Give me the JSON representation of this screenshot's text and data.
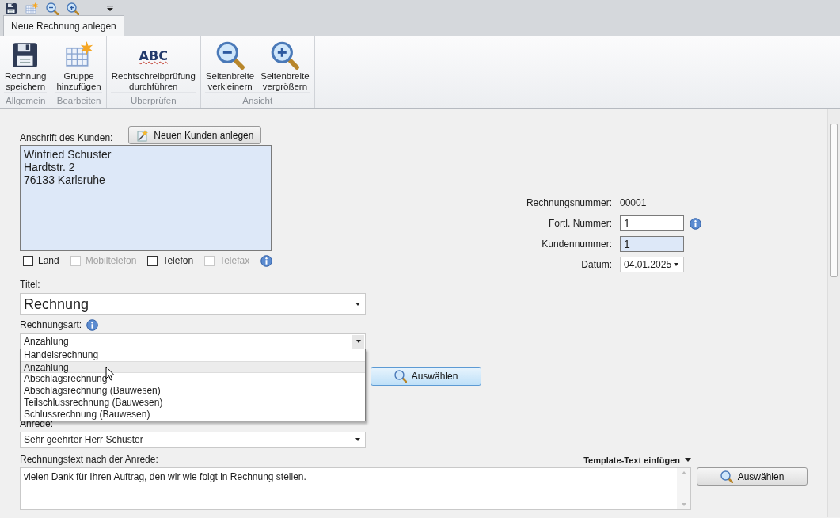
{
  "tabs": [
    {
      "label": "Neue Rechnung anlegen",
      "selected": true
    }
  ],
  "ribbon_groups": [
    {
      "label": "Allgemein",
      "buttons": [
        {
          "kind": "save",
          "label": "Rechnung\nspeichern"
        }
      ]
    },
    {
      "label": "Bearbeiten",
      "buttons": [
        {
          "kind": "grid",
          "label": "Gruppe\nhinzufügen"
        }
      ]
    },
    {
      "label": "Überprüfen",
      "buttons": [
        {
          "kind": "spell",
          "icon_text": "ABC",
          "label": "Rechtschreibprüfung\ndurchführen"
        }
      ]
    },
    {
      "label": "Ansicht",
      "buttons": [
        {
          "kind": "zoomout",
          "label": "Seitenbreite\nverkleinern"
        },
        {
          "kind": "zoomin",
          "label": "Seitenbreite\nvergrößern"
        }
      ]
    }
  ],
  "customer": {
    "label": "Anschrift des Kunden:",
    "new_button": "Neuen Kunden anlegen",
    "address": "Winfried Schuster\nHardtstr. 2\n76133 Karlsruhe",
    "options": [
      {
        "label": "Land",
        "checked": false,
        "disabled": false
      },
      {
        "label": "Mobiltelefon",
        "checked": false,
        "disabled": true
      },
      {
        "label": "Telefon",
        "checked": false,
        "disabled": false
      },
      {
        "label": "Telefax",
        "checked": false,
        "disabled": true
      }
    ]
  },
  "invoice_info": [
    {
      "kind": "text",
      "label": "Rechnungsnummer:",
      "value": "00001"
    },
    {
      "kind": "input",
      "label": "Fortl. Nummer:",
      "value": "1"
    },
    {
      "kind": "readonly",
      "label": "Kundennummer:",
      "value": "1"
    },
    {
      "kind": "date",
      "label": "Datum:",
      "value": "04.01.2025"
    }
  ],
  "title": {
    "label": "Titel:",
    "value": "Rechnung"
  },
  "invoice_type": {
    "label": "Rechnungsart:",
    "value": "Anzahlung",
    "expanded": true,
    "options": [
      {
        "label": "Handelsrechnung",
        "selected": false
      },
      {
        "label": "Anzahlung",
        "selected": true
      },
      {
        "label": "Abschlagsrechnung",
        "selected": false
      },
      {
        "label": "Abschlagsrechnung (Bauwesen)",
        "selected": false
      },
      {
        "label": "Teilschlussrechnung (Bauwesen)",
        "selected": false
      },
      {
        "label": "Schlussrechnung (Bauwesen)",
        "selected": false
      }
    ]
  },
  "select_button": "Auswählen",
  "salutation": {
    "label": "Anrede:",
    "value": "Sehr geehrter Herr Schuster"
  },
  "body_text": {
    "label": "Rechnungstext nach der Anrede:",
    "template_menu": "Template-Text einfügen",
    "value": "vielen Dank für Ihren Auftrag, den wir wie folgt in Rechnung stellen.",
    "button": "Auswählen"
  }
}
